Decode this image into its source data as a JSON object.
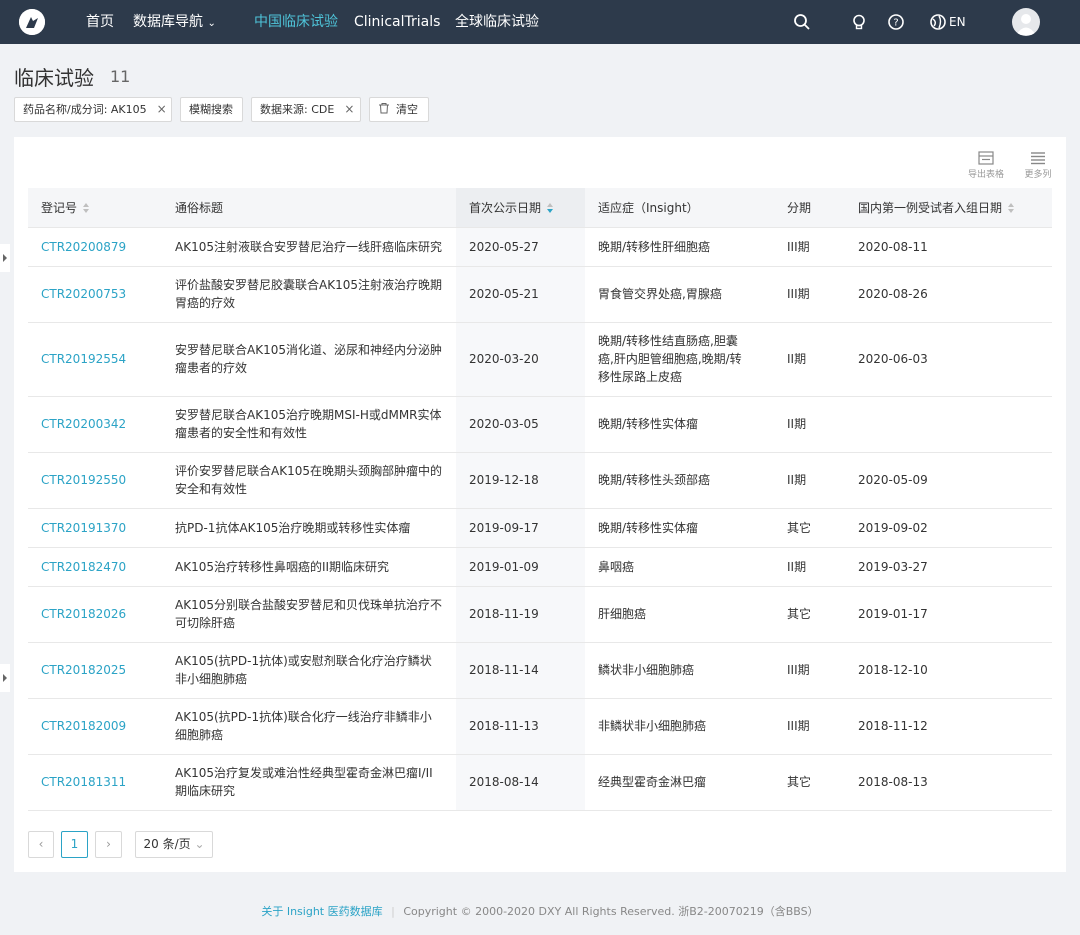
{
  "nav": {
    "home": "首页",
    "db_nav": "数据库导航",
    "china_trials": "中国临床试验",
    "clinicaltrials": "ClinicalTrials",
    "global_trials": "全球临床试验",
    "lang": "EN"
  },
  "page": {
    "title": "临床试验",
    "count": "11"
  },
  "filters": {
    "drug": "药品名称/成分词: AK105",
    "fuzzy": "模糊搜索",
    "source": "数据来源: CDE",
    "clear": "清空",
    "close_glyph": "×"
  },
  "toolbar": {
    "export": "导出表格",
    "more_cols": "更多列"
  },
  "table": {
    "headers": [
      "登记号",
      "通俗标题",
      "首次公示日期",
      "适应症（Insight）",
      "分期",
      "国内第一例受试者入组日期"
    ],
    "rows": [
      [
        "CTR20200879",
        "AK105注射液联合安罗替尼治疗一线肝癌临床研究",
        "2020-05-27",
        "晚期/转移性肝细胞癌",
        "III期",
        "2020-08-11"
      ],
      [
        "CTR20200753",
        "评价盐酸安罗替尼胶囊联合AK105注射液治疗晚期胃癌的疗效",
        "2020-05-21",
        "胃食管交界处癌,胃腺癌",
        "III期",
        "2020-08-26"
      ],
      [
        "CTR20192554",
        "安罗替尼联合AK105消化道、泌尿和神经内分泌肿瘤患者的疗效",
        "2020-03-20",
        "晚期/转移性结直肠癌,胆囊癌,肝内胆管细胞癌,晚期/转移性尿路上皮癌",
        "II期",
        "2020-06-03"
      ],
      [
        "CTR20200342",
        "安罗替尼联合AK105治疗晚期MSI-H或dMMR实体瘤患者的安全性和有效性",
        "2020-03-05",
        "晚期/转移性实体瘤",
        "II期",
        ""
      ],
      [
        "CTR20192550",
        "评价安罗替尼联合AK105在晚期头颈胸部肿瘤中的安全和有效性",
        "2019-12-18",
        "晚期/转移性头颈部癌",
        "II期",
        "2020-05-09"
      ],
      [
        "CTR20191370",
        "抗PD-1抗体AK105治疗晚期或转移性实体瘤",
        "2019-09-17",
        "晚期/转移性实体瘤",
        "其它",
        "2019-09-02"
      ],
      [
        "CTR20182470",
        "AK105治疗转移性鼻咽癌的II期临床研究",
        "2019-01-09",
        "鼻咽癌",
        "II期",
        "2019-03-27"
      ],
      [
        "CTR20182026",
        "AK105分别联合盐酸安罗替尼和贝伐珠单抗治疗不可切除肝癌",
        "2018-11-19",
        "肝细胞癌",
        "其它",
        "2019-01-17"
      ],
      [
        "CTR20182025",
        "AK105(抗PD-1抗体)或安慰剂联合化疗治疗鳞状非小细胞肺癌",
        "2018-11-14",
        "鳞状非小细胞肺癌",
        "III期",
        "2018-12-10"
      ],
      [
        "CTR20182009",
        "AK105(抗PD-1抗体)联合化疗一线治疗非鳞非小细胞肺癌",
        "2018-11-13",
        "非鳞状非小细胞肺癌",
        "III期",
        "2018-11-12"
      ],
      [
        "CTR20181311",
        "AK105治疗复发或难治性经典型霍奇金淋巴瘤I/II期临床研究",
        "2018-08-14",
        "经典型霍奇金淋巴瘤",
        "其它",
        "2018-08-13"
      ]
    ]
  },
  "pagination": {
    "prev": "‹",
    "current": "1",
    "next": "›",
    "page_size": "20 条/页"
  },
  "footer": {
    "about": "关于 Insight 医药数据库",
    "copyright": "Copyright © 2000-2020 DXY All Rights Reserved. 浙B2-20070219（含BBS）"
  },
  "colors": {
    "topbar": "#2d3a4b",
    "accent": "#2ba3c6",
    "active_nav": "#4ec3d8"
  }
}
